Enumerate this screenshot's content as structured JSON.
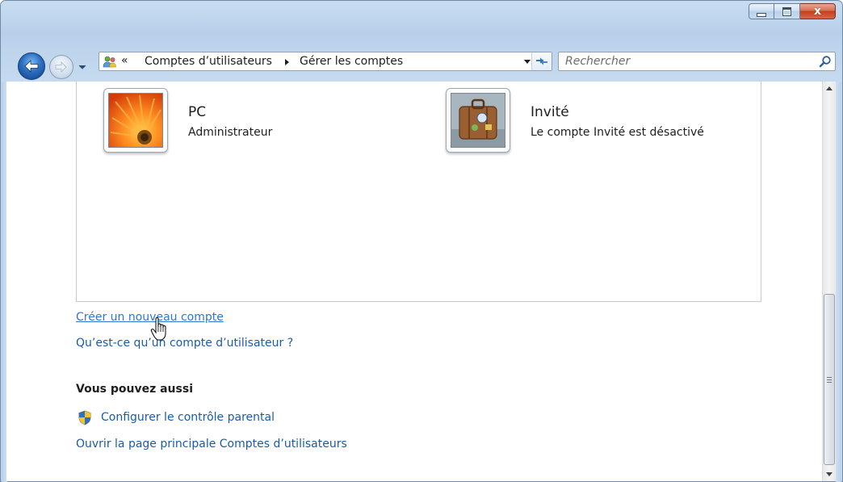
{
  "window": {
    "caption_buttons": [
      "minimize",
      "maximize",
      "close"
    ],
    "close_glyph": "x"
  },
  "nav": {
    "back_icon": "back-arrow-icon",
    "forward_icon": "forward-arrow-icon",
    "recent_icon": "chevron-down-icon"
  },
  "address": {
    "icon": "user-accounts-icon",
    "overflow": "«",
    "segments": [
      "Comptes d’utilisateurs",
      "Gérer les comptes"
    ]
  },
  "search": {
    "placeholder": "Rechercher",
    "icon": "search-icon"
  },
  "accounts": [
    {
      "name": "PC",
      "subtitle": "Administrateur",
      "picture": "orange-flower-picture"
    },
    {
      "name": "Invité",
      "subtitle": "Le compte Invité est désactivé",
      "picture": "suitcase-picture"
    }
  ],
  "links": {
    "create_account": "Créer un nouveau compte",
    "what_is_account": "Qu’est-ce qu’un compte d’utilisateur ?"
  },
  "also": {
    "title": "Vous pouvez aussi",
    "parental_controls": "Configurer le contrôle parental",
    "main_page": "Ouvrir la page principale Comptes d’utilisateurs"
  },
  "colors": {
    "link": "#1a5ca8",
    "link_hover": "#2c77d4",
    "frame": "#bdd4ec"
  }
}
